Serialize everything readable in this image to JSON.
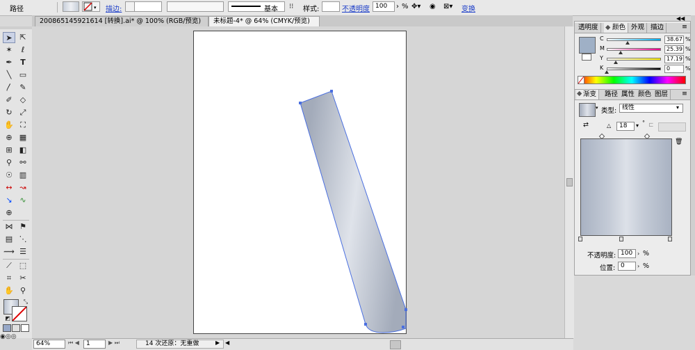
{
  "control_bar": {
    "object_label": "路径",
    "stroke_label": "描边:",
    "stroke_weight": "",
    "line_style": "基本",
    "style_label": "样式:",
    "opacity_label": "不透明度",
    "opacity_value": "100",
    "opacity_unit": "%",
    "transform_label": "变换"
  },
  "documents": {
    "tabs": [
      {
        "label": "200865145921614  [转换].ai* @ 100% (RGB/预览)"
      },
      {
        "label": "未标题-4* @ 64% (CMYK/预览)"
      }
    ],
    "close_glyph": "×"
  },
  "toolbox": {
    "text_tool": "T",
    "symbol_sprayer_label": "☉"
  },
  "status_bar": {
    "zoom": "64%",
    "artboard_number": "1",
    "undo_status": "14 次还原：无重做"
  },
  "color_panel": {
    "tabs": [
      "透明度",
      "颜色",
      "外观",
      "描边"
    ],
    "active_tab": "颜色",
    "channels": [
      {
        "label": "C",
        "value": "38.67",
        "fraction": 0.3867
      },
      {
        "label": "M",
        "value": "25.39",
        "fraction": 0.2539
      },
      {
        "label": "Y",
        "value": "17.19",
        "fraction": 0.1719
      },
      {
        "label": "K",
        "value": "0",
        "fraction": 0.0
      }
    ],
    "unit": "%"
  },
  "gradient_panel": {
    "tabs": [
      "渐变",
      "路径",
      "属性",
      "颜色",
      "图层"
    ],
    "active_tab": "渐变",
    "type_label": "类型:",
    "type_value": "线性",
    "angle_symbol": "△",
    "angle_value": "18",
    "degree_symbol": "°",
    "opacity_label": "不透明度:",
    "opacity_value": "100",
    "location_label": "位置:",
    "location_value": "0",
    "unit": "%"
  },
  "colors": {
    "shape_light": "#dfe3ea",
    "shape_dark": "#a3abba",
    "selection": "#4a6fe0",
    "link_blue": "#1a3cc8"
  }
}
